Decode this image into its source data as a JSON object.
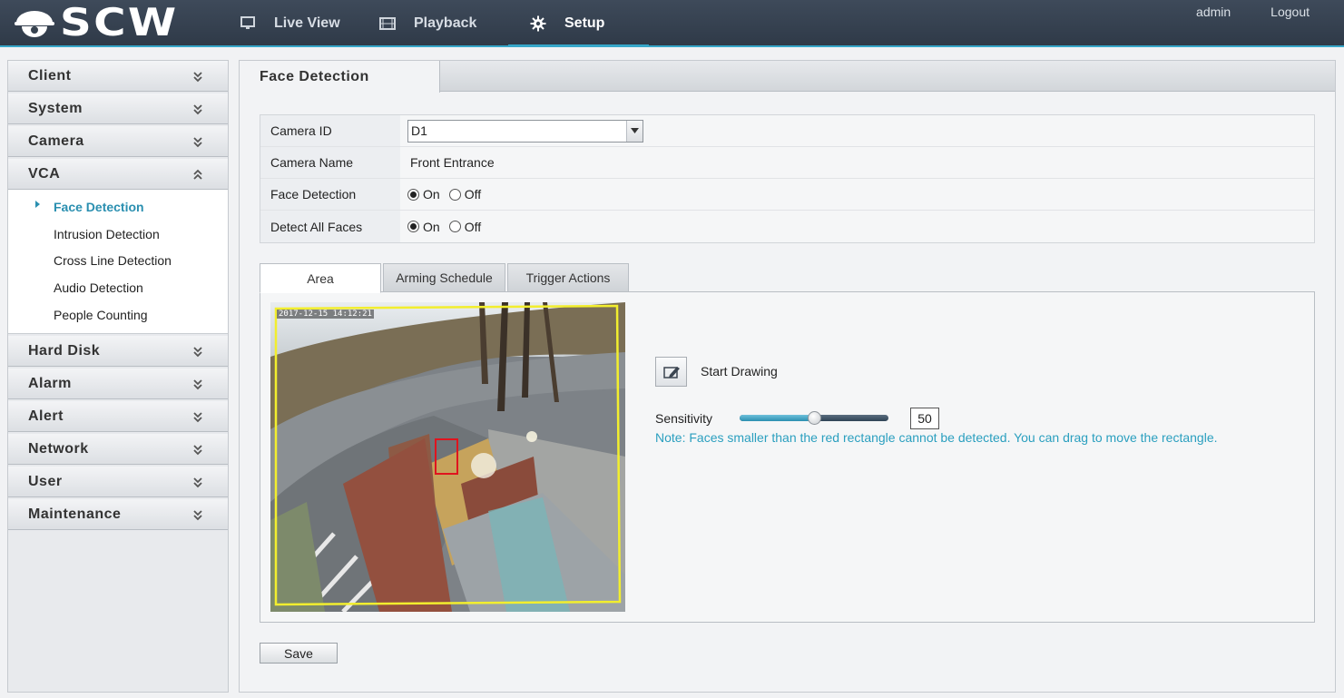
{
  "app": {
    "logo_text": "SCW"
  },
  "nav": [
    {
      "label": "Live View",
      "icon": "monitor-icon"
    },
    {
      "label": "Playback",
      "icon": "film-icon"
    },
    {
      "label": "Setup",
      "icon": "gear-icon",
      "active": true
    }
  ],
  "user": {
    "name": "admin",
    "logout": "Logout"
  },
  "sidebar": {
    "sections": [
      {
        "label": "Client"
      },
      {
        "label": "System"
      },
      {
        "label": "Camera"
      },
      {
        "label": "VCA",
        "expanded": true
      },
      {
        "label": "Hard Disk"
      },
      {
        "label": "Alarm"
      },
      {
        "label": "Alert"
      },
      {
        "label": "Network"
      },
      {
        "label": "User"
      },
      {
        "label": "Maintenance"
      }
    ],
    "vca_items": [
      {
        "label": "Face Detection",
        "active": true
      },
      {
        "label": "Intrusion Detection"
      },
      {
        "label": "Cross Line Detection"
      },
      {
        "label": "Audio Detection"
      },
      {
        "label": "People Counting"
      }
    ]
  },
  "page": {
    "title": "Face Detection",
    "form": {
      "camera_id": {
        "label": "Camera ID",
        "value": "D1"
      },
      "camera_name": {
        "label": "Camera Name",
        "value": "Front Entrance"
      },
      "face_detection": {
        "label": "Face Detection",
        "on": "On",
        "off": "Off",
        "selected": "On"
      },
      "detect_all": {
        "label": "Detect All Faces",
        "on": "On",
        "off": "Off",
        "selected": "On"
      }
    },
    "tabs": [
      {
        "label": "Area",
        "active": true
      },
      {
        "label": "Arming Schedule"
      },
      {
        "label": "Trigger Actions"
      }
    ],
    "area": {
      "osd_timestamp": "2017-12-15 14:12:21",
      "start_drawing": "Start Drawing",
      "sensitivity_label": "Sensitivity",
      "sensitivity_value": "50",
      "sensitivity_fraction": 0.5,
      "note": "Note: Faces smaller than the red rectangle cannot be detected. You can drag to move the rectangle."
    },
    "save_label": "Save"
  },
  "colors": {
    "accent": "#2a8fb0",
    "topbar": "#37424f",
    "area_outline": "#f2ee2e",
    "min_face_rect": "#e0141e"
  }
}
